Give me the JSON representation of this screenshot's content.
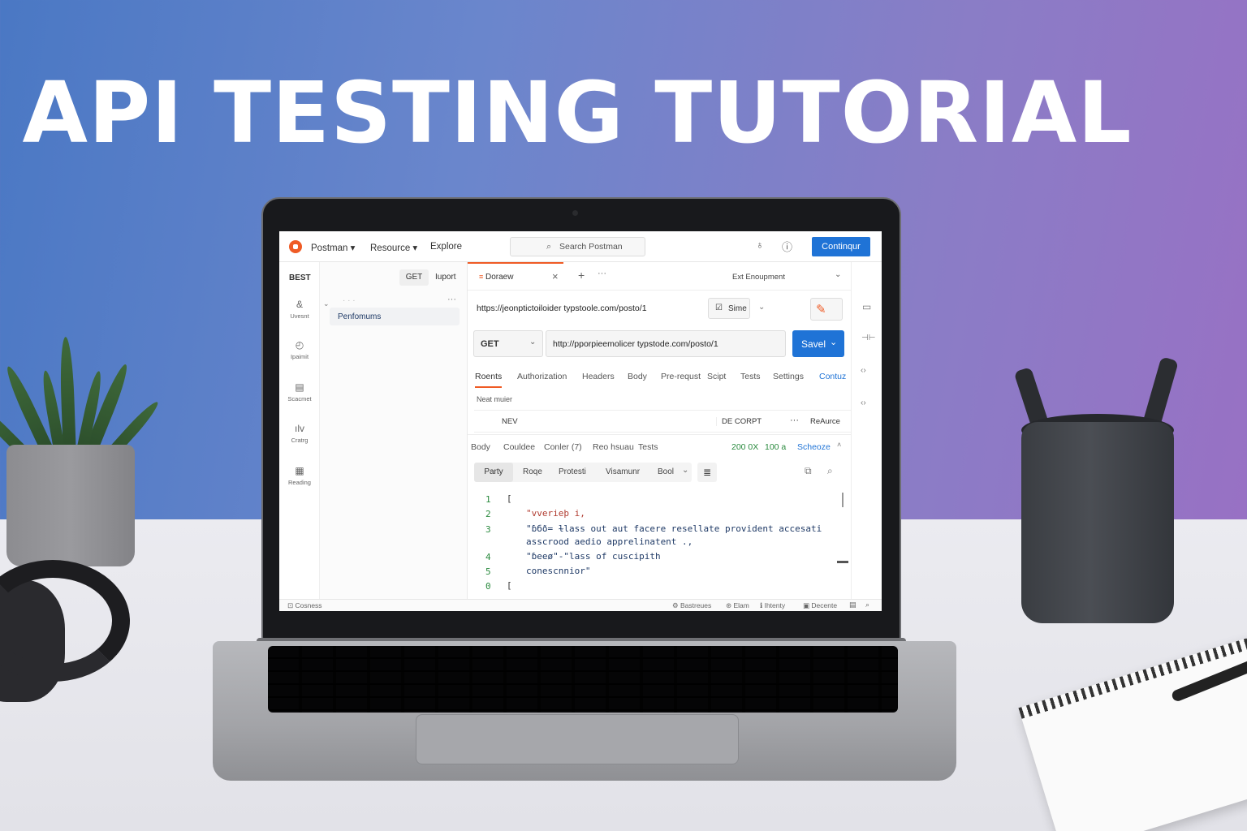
{
  "headline": "API TESTING TUTORIAL",
  "colors": {
    "brand": "#ef5b25",
    "primary": "#1f73d6",
    "status_ok": "#2a8a3e"
  },
  "topbar": {
    "app": "Postman",
    "menu": [
      "Resource",
      "Explore"
    ],
    "search_placeholder": "Search Postman",
    "cta": "Continqur",
    "icons": [
      "satellite-icon",
      "info-icon"
    ]
  },
  "sidebar": {
    "items": [
      {
        "icon": "link-icon",
        "label": "Uvesnt"
      },
      {
        "icon": "history-icon",
        "label": "Ipaimit"
      },
      {
        "icon": "grid-icon",
        "label": "Scacmet"
      },
      {
        "icon": "flow-icon",
        "label": "Cratrg"
      },
      {
        "icon": "calendar-icon",
        "label": "Reading"
      }
    ]
  },
  "collections": {
    "title": "BEST",
    "get_btn": "GET",
    "import_btn": "Iuport",
    "item": "Penfomums"
  },
  "request_tab": {
    "name": "Doraew",
    "environment": "Ext Enoupment",
    "url_preview": "https://jeonptictoiloider typstoole.com/posto/1",
    "save_small": "Sime"
  },
  "request": {
    "method": "GET",
    "url": "http://pporpieemolicer typstode.com/posto/1",
    "send": "Savel"
  },
  "req_tabs": [
    "Roents",
    "Authorization",
    "Headers",
    "Body",
    "Pre-requst",
    "Scipt",
    "Tests",
    "Settings",
    "Contuz"
  ],
  "params": {
    "heading": "Neat muier",
    "key": "NEV",
    "desc": "DE CORPT",
    "more": "ReAurce"
  },
  "response": {
    "tabs": [
      "Body",
      "Couldee",
      "Conler (7)",
      "Reo hsuau",
      "Tests"
    ],
    "status": "200 0X",
    "time": "100 a",
    "save": "Scheoze",
    "views": [
      "Party",
      "Roqe",
      "Protesti",
      "Visamunr",
      "Bool"
    ],
    "lines": [
      {
        "n": "1",
        "code": "["
      },
      {
        "n": "2",
        "code": "\"vverieþ i,"
      },
      {
        "n": "3",
        "code": "\"ɓбð= ɫlass out aut facere resellate provident accesati"
      },
      {
        "n": "",
        "code": "asscrood aedio apprelinatent .,"
      },
      {
        "n": "4",
        "code": "\"ɓeeø\"-\"lass of cuscipith"
      },
      {
        "n": "5",
        "code": "  conescnnior\""
      },
      {
        "n": "0",
        "code": "["
      }
    ]
  },
  "status_bar": {
    "left": "Cosness",
    "right": [
      "Bastreues",
      "Elam",
      "Ihtenty",
      "Decente"
    ]
  }
}
